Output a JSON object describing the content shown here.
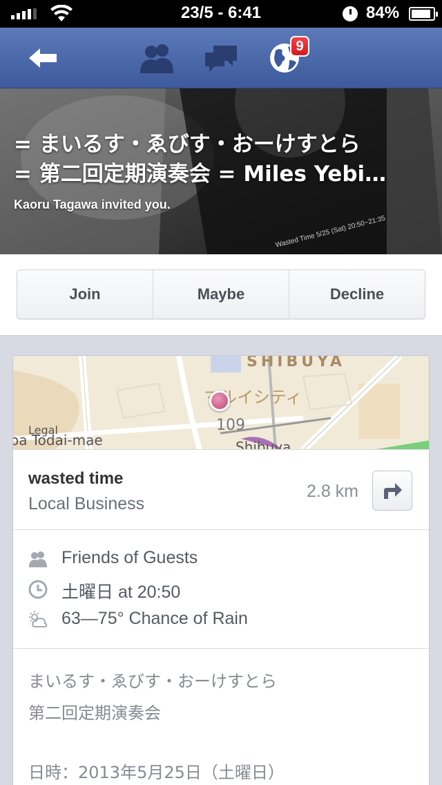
{
  "status_bar": {
    "time": "23/5 - 6:41",
    "battery": "84%"
  },
  "nav": {
    "notification_count": "9",
    "icons": [
      "back-arrow-icon",
      "friends-icon",
      "messages-icon",
      "globe-icon"
    ]
  },
  "event": {
    "title_line1": "= まいるす・ゑびす・おーけすとら",
    "title_line2": "= 第二回定期演奏会 = Miles Yebi…",
    "invited_by": "Kaoru Tagawa invited you.",
    "cover_caption": "Wasted Time 5/25 (Sat) 20:50~21:35"
  },
  "rsvp": {
    "join": "Join",
    "maybe": "Maybe",
    "decline": "Decline"
  },
  "map": {
    "district": "SHIBUYA",
    "landmark": "マルイシティ",
    "building": "109",
    "station_left": "oa Todai-mae",
    "station": "Shibuya",
    "legal": "Legal"
  },
  "place": {
    "name": "wasted time",
    "type": "Local Business",
    "distance": "2.8 km"
  },
  "details": {
    "privacy": "Friends of Guests",
    "time": "土曜日 at 20:50",
    "weather": "63—75° Chance of Rain"
  },
  "description": {
    "line1": "まいるす・ゑびす・おーけすとら",
    "line2": "第二回定期演奏会",
    "line3": "日時：2013年5月25日（土曜日）"
  }
}
